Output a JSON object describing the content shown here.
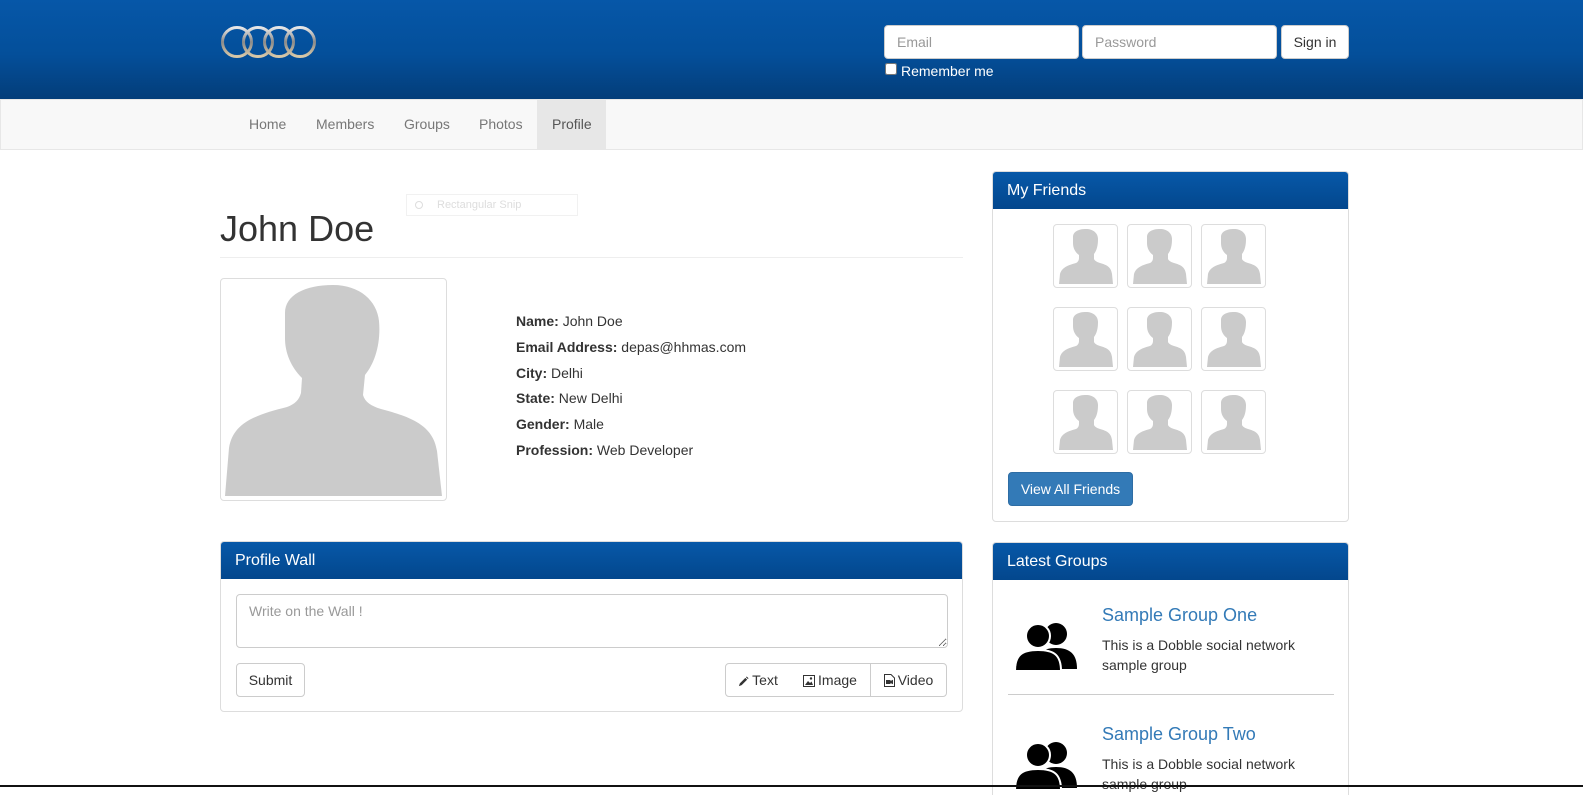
{
  "header": {
    "brand_colors": {
      "top": "#0657a8",
      "bottom": "#033d79"
    },
    "email_placeholder": "Email",
    "password_placeholder": "Password",
    "signin_label": "Sign in",
    "remember_label": "Remember me"
  },
  "nav": {
    "items": [
      {
        "label": "Home",
        "active": false
      },
      {
        "label": "Members",
        "active": false
      },
      {
        "label": "Groups",
        "active": false
      },
      {
        "label": "Photos",
        "active": false
      },
      {
        "label": "Profile",
        "active": true
      }
    ]
  },
  "profile": {
    "title": "John Doe",
    "ghost_label": "Rectangular Snip",
    "fields": [
      {
        "label": "Name:",
        "value": "John Doe"
      },
      {
        "label": "Email Address:",
        "value": "depas@hhmas.com"
      },
      {
        "label": "City:",
        "value": "Delhi"
      },
      {
        "label": "State:",
        "value": "New Delhi"
      },
      {
        "label": "Gender:",
        "value": "Male"
      },
      {
        "label": "Profession:",
        "value": "Web Developer"
      }
    ]
  },
  "wall": {
    "heading": "Profile Wall",
    "placeholder": "Write on the Wall !",
    "submit_label": "Submit",
    "text_label": "Text",
    "image_label": "Image",
    "video_label": "Video"
  },
  "friends": {
    "heading": "My Friends",
    "count": 9,
    "view_all_label": "View All Friends"
  },
  "groups": {
    "heading": "Latest Groups",
    "items": [
      {
        "name": "Sample Group One",
        "description": "This is a Dobble social network sample group"
      },
      {
        "name": "Sample Group Two",
        "description": "This is a Dobble social network sample group"
      }
    ]
  }
}
